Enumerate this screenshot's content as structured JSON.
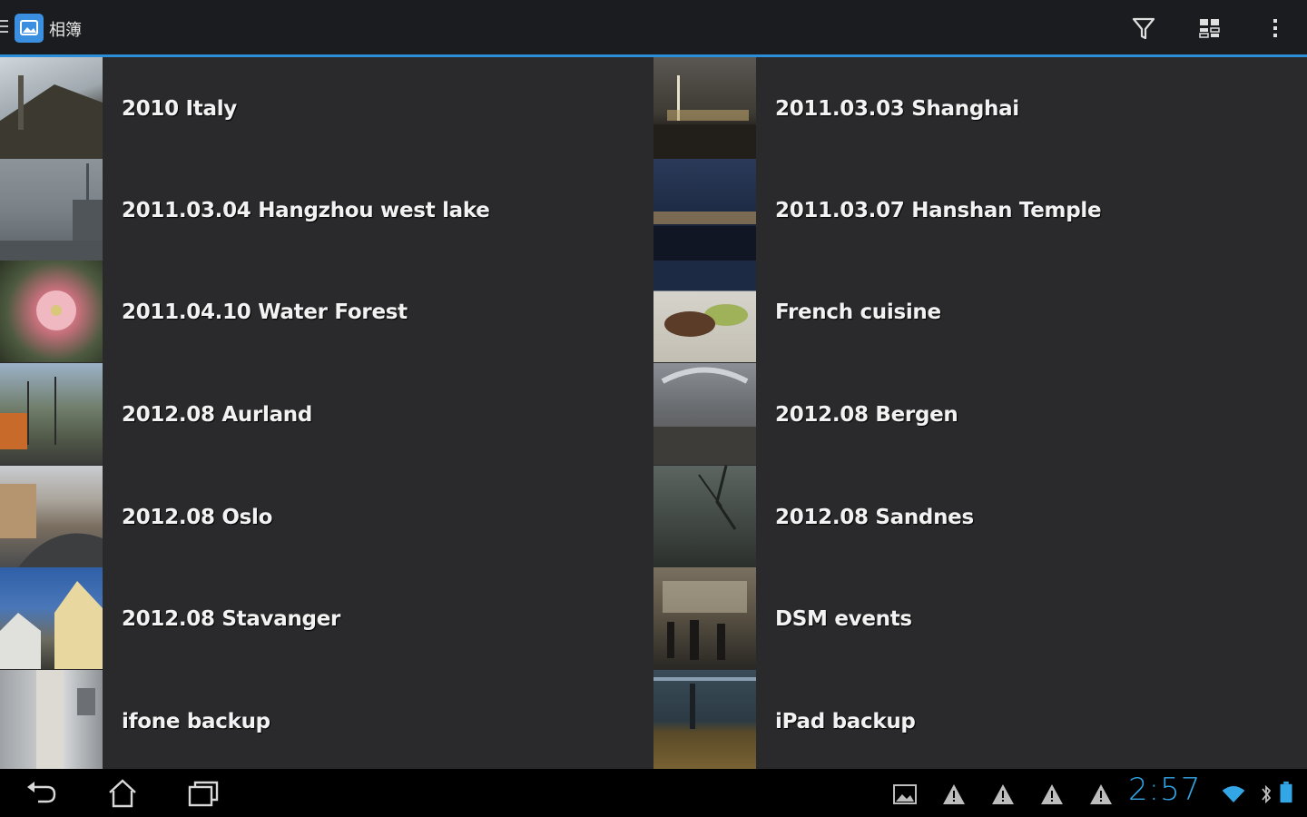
{
  "app": {
    "title": "相簿"
  },
  "actions": [
    {
      "name": "filter-icon"
    },
    {
      "name": "view-mode-icon"
    },
    {
      "name": "overflow-menu-icon"
    }
  ],
  "albums": [
    {
      "title": "2010 Italy",
      "icon": "photo-thumbnail"
    },
    {
      "title": "2011.03.03 Shanghai",
      "icon": "photo-thumbnail"
    },
    {
      "title": "2011.03.04 Hangzhou west lake",
      "icon": "photo-thumbnail"
    },
    {
      "title": "2011.03.07 Hanshan Temple",
      "icon": "photo-thumbnail"
    },
    {
      "title": "2011.04.10 Water Forest",
      "icon": "photo-thumbnail"
    },
    {
      "title": "French cuisine",
      "icon": "photo-thumbnail"
    },
    {
      "title": "2012.08 Aurland",
      "icon": "photo-thumbnail"
    },
    {
      "title": "2012.08 Bergen",
      "icon": "photo-thumbnail"
    },
    {
      "title": "2012.08 Oslo",
      "icon": "photo-thumbnail"
    },
    {
      "title": "2012.08 Sandnes",
      "icon": "photo-thumbnail"
    },
    {
      "title": "2012.08 Stavanger",
      "icon": "photo-thumbnail"
    },
    {
      "title": "DSM events",
      "icon": "photo-thumbnail"
    },
    {
      "title": "ifone backup",
      "icon": "photo-thumbnail"
    },
    {
      "title": "iPad backup",
      "icon": "photo-thumbnail"
    }
  ],
  "system": {
    "clock": "2:57",
    "accent_color": "#33a6e6"
  },
  "colors": {
    "background": "#2a2a2c",
    "actionbar": "#1b1c1f",
    "accent": "#2a8fd8"
  }
}
